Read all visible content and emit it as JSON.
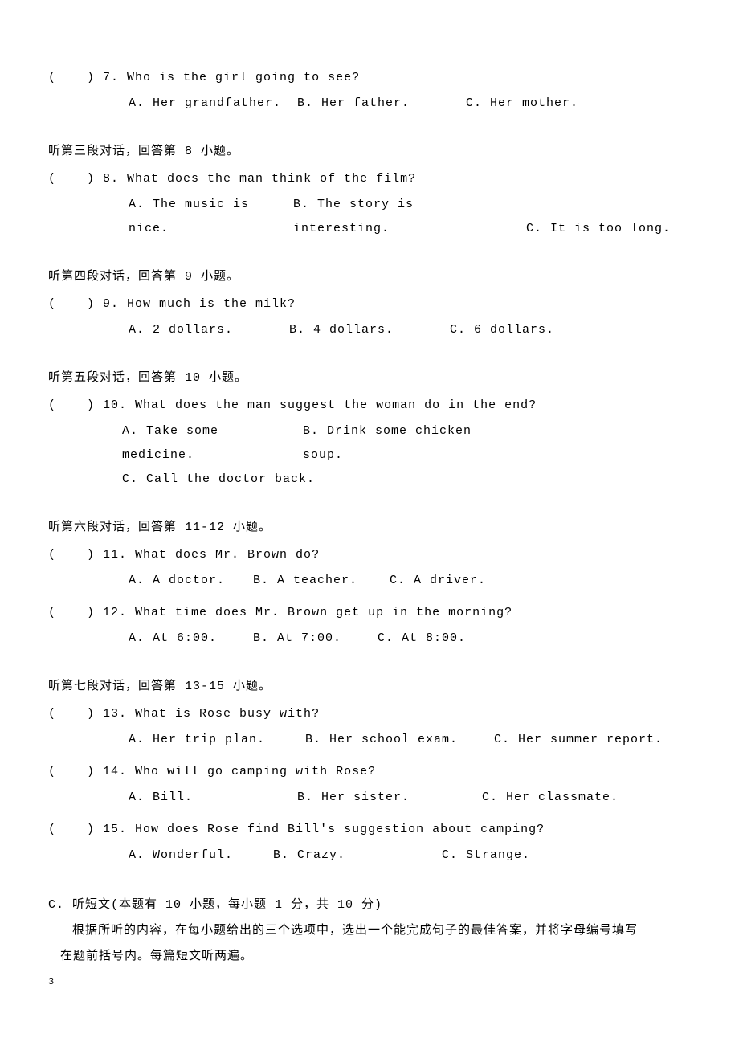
{
  "q7": {
    "prefix": "(",
    "blank": "     ",
    "suffix": ") 7. ",
    "text": "Who is the girl going to see?",
    "a": "A. Her grandfather.",
    "b": "B. Her father.",
    "c": "C. Her mother."
  },
  "sec3": "听第三段对话，回答第 8 小题。",
  "q8": {
    "prefix": "(",
    "blank": "     ",
    "suffix": ") 8. ",
    "text": "What does the man think of the film?",
    "a": "A. The music is nice.",
    "b": "B. The story is interesting.",
    "c": "C. It is too long."
  },
  "sec4": "听第四段对话，回答第 9 小题。",
  "q9": {
    "prefix": "(",
    "blank": "     ",
    "suffix": ") 9. ",
    "text": "How much is the milk?",
    "a": "A. 2 dollars.",
    "b": "B. 4 dollars.",
    "c": "C. 6 dollars."
  },
  "sec5": "听第五段对话，回答第 10 小题。",
  "q10": {
    "prefix": "(",
    "blank": "     ",
    "suffix": ") 10. ",
    "text": "What does the man suggest the woman do in the end?",
    "a": "A. Take some medicine.",
    "b": "B. Drink some chicken soup.",
    "c": "C. Call the doctor back."
  },
  "sec6": "听第六段对话，回答第 11-12 小题。",
  "q11": {
    "prefix": "(",
    "blank": "     ",
    "suffix": ") 11. ",
    "text": "What does Mr. Brown do?",
    "a": "A. A doctor.",
    "b": "B. A teacher.",
    "c": "C. A driver."
  },
  "q12": {
    "prefix": "(",
    "blank": "     ",
    "suffix": ") 12. ",
    "text": "What time does Mr. Brown get up in the morning?",
    "a": "A. At 6:00.",
    "b": "B. At 7:00.",
    "c": "C. At 8:00."
  },
  "sec7": "听第七段对话，回答第 13-15 小题。",
  "q13": {
    "prefix": "(",
    "blank": "     ",
    "suffix": ") 13. ",
    "text": "What is Rose busy with?",
    "a": "A. Her trip plan.",
    "b": "B. Her school exam.",
    "c": "C. Her summer report."
  },
  "q14": {
    "prefix": "(",
    "blank": "     ",
    "suffix": ") 14. ",
    "text": "Who will go camping with Rose?",
    "a": "A. Bill.",
    "b": "B. Her sister.",
    "c": "C. Her classmate."
  },
  "q15": {
    "prefix": "(",
    "blank": "     ",
    "suffix": ") 15. ",
    "text": "How does Rose find Bill's suggestion about camping?",
    "a": "A. Wonderful.",
    "b": "B. Crazy.",
    "c": "C. Strange."
  },
  "sectionC": {
    "title": "C. 听短文(本题有 10 小题，每小题 1 分，共 10 分)",
    "line1": "根据所听的内容，在每小题给出的三个选项中，选出一个能完成句子的最佳答案，并将字母编号填写",
    "line2": "在题前括号内。每篇短文听两遍。"
  },
  "pageNum": "3"
}
